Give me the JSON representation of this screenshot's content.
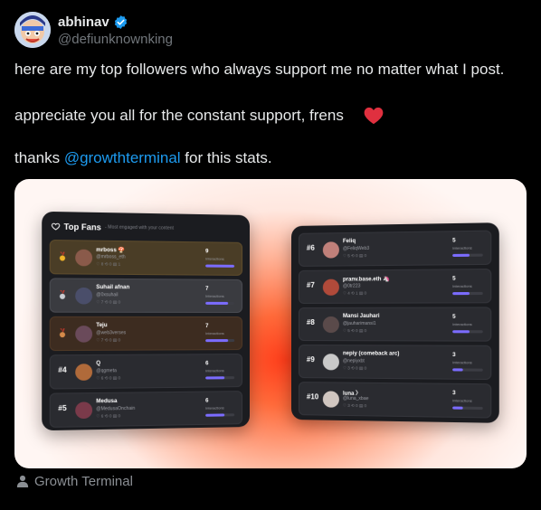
{
  "author": {
    "name": "abhinav",
    "handle": "@defiunknownking"
  },
  "tweet": {
    "line1": "here are my top followers who always support me no matter what I post.",
    "line2": "appreciate you all for the constant support, frens",
    "line3_prefix": "thanks ",
    "line3_mention": "@growthterminal",
    "line3_suffix": " for this stats."
  },
  "card": {
    "title": "Top Fans",
    "subtitle": "- Most engaged with your content",
    "interactions_label": "Interactions"
  },
  "fans": [
    {
      "rank": "",
      "medal": "gold",
      "name": "mrboss 🍄",
      "handle": "@mrboss_eth",
      "stats": "♡ 8  ⟲ 0  ▤ 1",
      "count": "9",
      "fill": 1.0,
      "color": "#8a5a4a"
    },
    {
      "rank": "",
      "medal": "silver",
      "name": "Suhail afnan",
      "handle": "@0xsuhail",
      "stats": "♡ 7  ⟲ 0  ▤ 0",
      "count": "7",
      "fill": 0.78,
      "color": "#4a4e6a"
    },
    {
      "rank": "",
      "medal": "bronze",
      "name": "Teju",
      "handle": "@web3verses",
      "stats": "♡ 7  ⟲ 0  ▤ 0",
      "count": "7",
      "fill": 0.78,
      "color": "#6a4a5a"
    },
    {
      "rank": "#4",
      "medal": "",
      "name": "Q",
      "handle": "@qgmeta",
      "stats": "♡ 6  ⟲ 0  ▤ 0",
      "count": "6",
      "fill": 0.67,
      "color": "#b06a3a"
    },
    {
      "rank": "#5",
      "medal": "",
      "name": "Medusa",
      "handle": "@MedusaOnchain",
      "stats": "♡ 6  ⟲ 0  ▤ 0",
      "count": "6",
      "fill": 0.67,
      "color": "#7a3a4a"
    },
    {
      "rank": "#6",
      "medal": "",
      "name": "Feliq",
      "handle": "@FeliqWeb3",
      "stats": "♡ 5  ⟲ 0  ▤ 0",
      "count": "5",
      "fill": 0.56,
      "color": "#c0807a"
    },
    {
      "rank": "#7",
      "medal": "",
      "name": "pranv.base.eth 🦄",
      "handle": "@0tr223",
      "stats": "♡ 4  ⟲ 1  ▤ 0",
      "count": "5",
      "fill": 0.56,
      "color": "#b04a3a"
    },
    {
      "rank": "#8",
      "medal": "",
      "name": "Mansi Jauhari",
      "handle": "@jauharimansi1",
      "stats": "♡ 5  ⟲ 0  ▤ 0",
      "count": "5",
      "fill": 0.56,
      "color": "#5a4a4a"
    },
    {
      "rank": "#9",
      "medal": "",
      "name": "nepiy (comeback arc)",
      "handle": "@nepiyxbt",
      "stats": "♡ 3  ⟲ 0  ▤ 0",
      "count": "3",
      "fill": 0.33,
      "color": "#c9c9c9"
    },
    {
      "rank": "#10",
      "medal": "",
      "name": "luna 〉",
      "handle": "@luna_xbae",
      "stats": "♡ 3  ⟲ 0  ▤ 0",
      "count": "3",
      "fill": 0.33,
      "color": "#d0c6c0"
    }
  ],
  "footer": {
    "text": "Growth Terminal"
  },
  "colors": {
    "accent": "#1d9bf0",
    "heart": "#f91880",
    "bar": "#7b6cff"
  }
}
